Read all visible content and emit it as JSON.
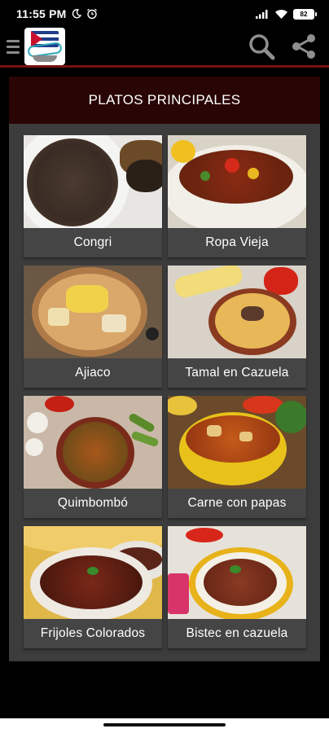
{
  "status_bar": {
    "time": "11:55 PM",
    "battery": "82",
    "icons": [
      "moon-icon",
      "alarm-icon",
      "signal-icon",
      "wifi-icon",
      "battery-icon"
    ]
  },
  "app_bar": {
    "icons": [
      "menu-icon",
      "app-logo",
      "search-icon",
      "share-icon"
    ]
  },
  "section": {
    "title": "PLATOS PRINCIPALES"
  },
  "recipes": [
    {
      "label": "Congri"
    },
    {
      "label": "Ropa Vieja"
    },
    {
      "label": "Ajiaco"
    },
    {
      "label": "Tamal en Cazuela"
    },
    {
      "label": "Quimbombó"
    },
    {
      "label": "Carne con papas"
    },
    {
      "label": "Frijoles Colorados"
    },
    {
      "label": "Bistec en cazuela"
    }
  ],
  "colors": {
    "accent_line": "#7a1010",
    "header_bg": "#2a0505",
    "panel_bg": "#3c3c3c",
    "card_label_bg": "#454545"
  }
}
